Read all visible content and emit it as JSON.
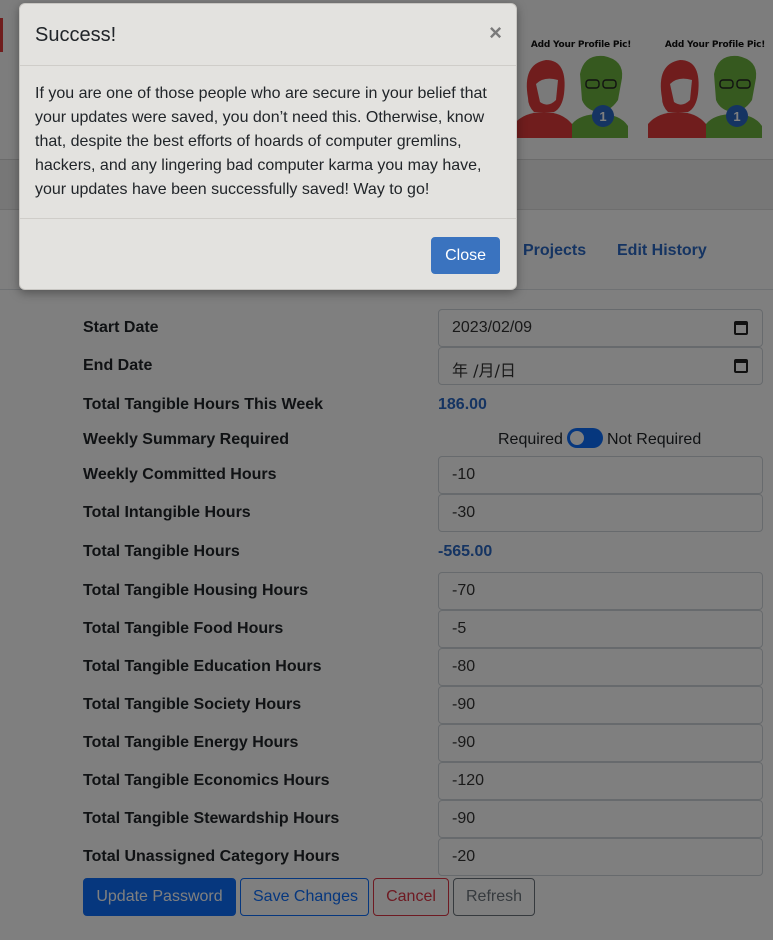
{
  "profile_pics": [
    {
      "caption": "Add Your Profile Pic!",
      "badge": "1"
    },
    {
      "caption": "Add Your Profile Pic!",
      "badge": "1"
    }
  ],
  "tabs": {
    "projects": "Projects",
    "edit_history": "Edit History"
  },
  "form": {
    "start_date": {
      "label": "Start Date",
      "value": "2023/02/09"
    },
    "end_date": {
      "label": "End Date",
      "value": "年 /月/日"
    },
    "tangible_week": {
      "label": "Total Tangible Hours This Week",
      "value": "186.00"
    },
    "summary_required": {
      "label": "Weekly Summary Required",
      "left": "Required",
      "right": "Not Required"
    },
    "committed": {
      "label": "Weekly Committed Hours",
      "value": "-10"
    },
    "intangible": {
      "label": "Total Intangible Hours",
      "value": "-30"
    },
    "tangible_total": {
      "label": "Total Tangible Hours",
      "value": "-565.00"
    },
    "housing": {
      "label": "Total Tangible Housing Hours",
      "value": "-70"
    },
    "food": {
      "label": "Total Tangible Food Hours",
      "value": "-5"
    },
    "education": {
      "label": "Total Tangible Education Hours",
      "value": "-80"
    },
    "society": {
      "label": "Total Tangible Society Hours",
      "value": "-90"
    },
    "energy": {
      "label": "Total Tangible Energy Hours",
      "value": "-90"
    },
    "economics": {
      "label": "Total Tangible Economics Hours",
      "value": "-120"
    },
    "stewardship": {
      "label": "Total Tangible Stewardship Hours",
      "value": "-90"
    },
    "unassigned": {
      "label": "Total Unassigned Category Hours",
      "value": "-20"
    }
  },
  "buttons": {
    "update_password": "Update Password",
    "save_changes": "Save Changes",
    "cancel": "Cancel",
    "refresh": "Refresh"
  },
  "modal": {
    "title": "Success!",
    "close_symbol": "×",
    "body": "If you are one of those people who are secure in your belief that your updates were saved, you don’t need this. Otherwise, know that, despite the best efforts of hoards of computer gremlins, hackers, and any lingering bad computer karma you may have, your updates have been successfully saved! Way to go!",
    "close_button": "Close"
  },
  "colors": {
    "primary": "#0d6efd",
    "danger": "#dc3545",
    "secondary": "#6c757d",
    "link": "#2b68c4",
    "avatar_red": "#e03b3b",
    "avatar_green": "#6cb33f"
  }
}
